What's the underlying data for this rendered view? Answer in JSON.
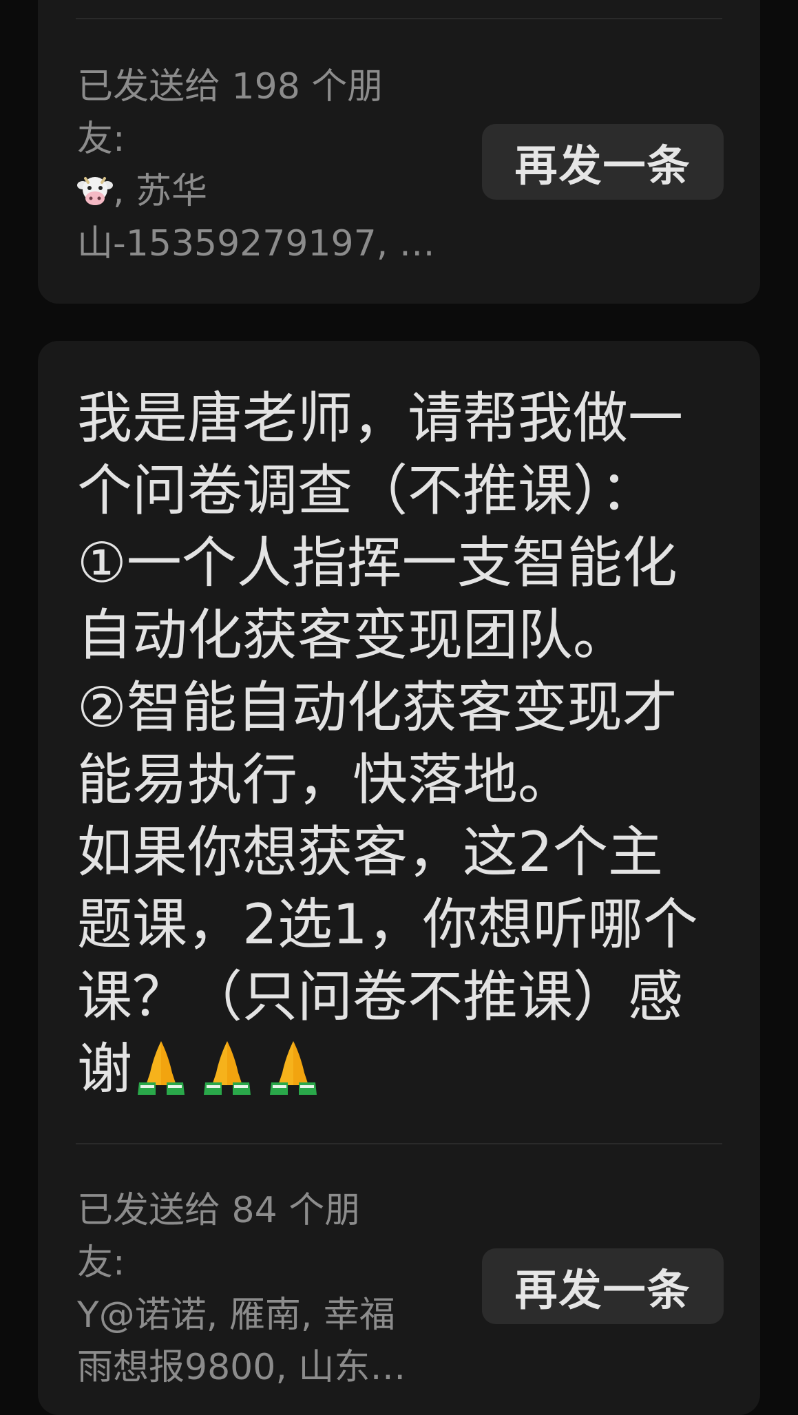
{
  "cards": [
    {
      "sent_lines": [
        "已发送给 198 个朋",
        "友:"
      ],
      "recipients_line3_emoji": "cow-face-icon",
      "recipients_line3_text": ", 苏华",
      "recipients_line4": "山-15359279197, …",
      "resend_label": "再发一条"
    },
    {
      "message_lines": [
        "我是唐老师，请帮我做一",
        "个问卷调查（不推课）：",
        "①一个人指挥一支智能化",
        "自动化获客变现团队。",
        "②智能自动化获客变现才",
        "能易执行，快落地。",
        "如果你想获客，这2个主",
        "题课，2选1，你想听哪个",
        "课？（只问卷不推课）感",
        "谢"
      ],
      "message_emoji": [
        "folded-hands-icon",
        "folded-hands-icon",
        "folded-hands-icon"
      ],
      "sent_lines": [
        "已发送给 84 个朋",
        "友:",
        "Y@诺诺, 雁南, 幸福",
        "雨想报9800, 山东…"
      ],
      "resend_label": "再发一条"
    }
  ],
  "colors": {
    "background": "#0b0b0b",
    "card": "#191919",
    "button": "#2c2c2c",
    "muted_text": "#8c8c8c",
    "message_text": "#e3e3e3"
  }
}
